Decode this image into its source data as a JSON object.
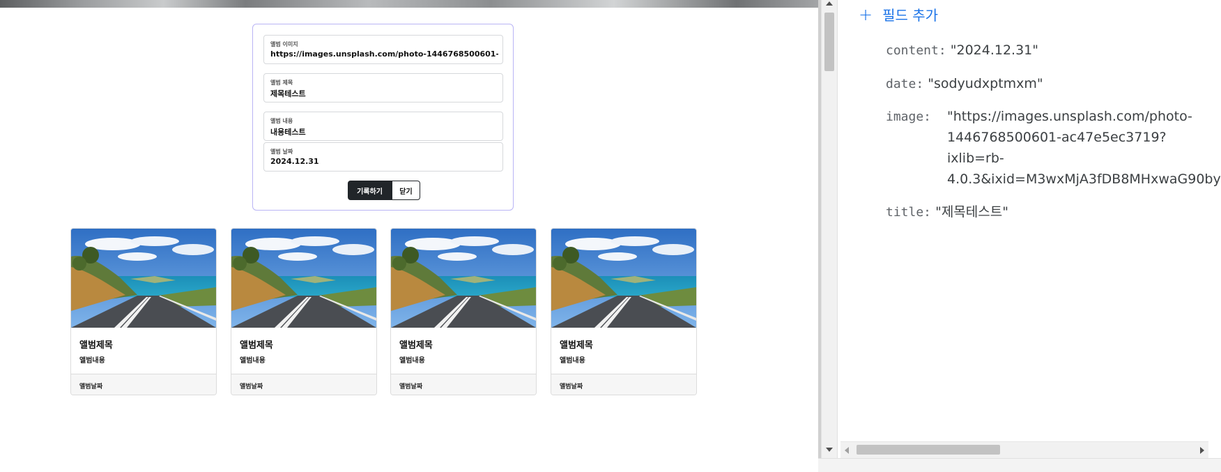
{
  "form": {
    "image_label": "앨범 이미지",
    "image_value": "https://images.unsplash.com/photo-1446768500601-ac47e5ec3719?ixlib=rb-4.0.3",
    "title_label": "앨범 제목",
    "title_value": "제목테스트",
    "content_label": "앨범 내용",
    "content_value": "내용테스트",
    "date_label": "앨범 날짜",
    "date_value": "2024.12.31",
    "submit_label": "기록하기",
    "close_label": "닫기"
  },
  "albums": [
    {
      "title": "앨범제목",
      "content": "앨범내용",
      "date": "앨범날짜"
    },
    {
      "title": "앨범제목",
      "content": "앨범내용",
      "date": "앨범날짜"
    },
    {
      "title": "앨범제목",
      "content": "앨범내용",
      "date": "앨범날짜"
    },
    {
      "title": "앨범제목",
      "content": "앨범내용",
      "date": "앨범날짜"
    }
  ],
  "document": {
    "add_field_label": "필드 추가",
    "fields": [
      {
        "key": "content:",
        "value": "\"2024.12.31\""
      },
      {
        "key": "date:",
        "value": "\"sodyudxptmxm\""
      },
      {
        "key": "image:",
        "value_lines": [
          "\"https://images.unsplash.com/photo-",
          "1446768500601-ac47e5ec3719?",
          "ixlib=rb-",
          "4.0.3&ixid=M3wxMjA3fDB8MHxwaG90by"
        ]
      },
      {
        "key": "title:",
        "value": "\"제목테스트\""
      }
    ]
  },
  "colors": {
    "accent": "#1a73e8",
    "form_border": "#b9b4f5",
    "button_dark": "#212529"
  }
}
